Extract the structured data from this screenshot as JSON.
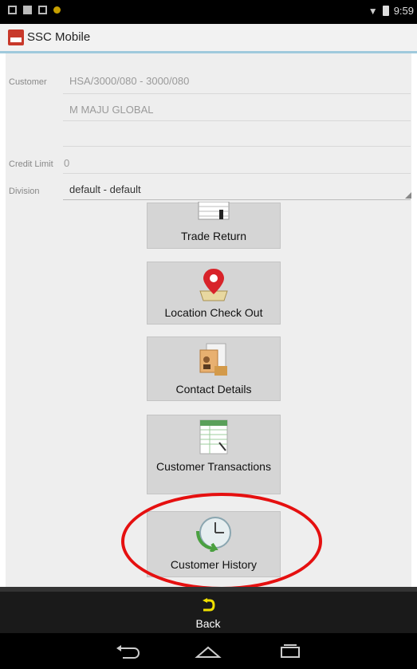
{
  "status_bar": {
    "time": "9:59",
    "icons": [
      "screenshot-icon",
      "sd-card-icon",
      "image-icon",
      "notification-dot-icon",
      "wifi-icon",
      "battery-icon"
    ]
  },
  "app": {
    "title": "SSC Mobile",
    "logo_icon": "ssc-logo-icon"
  },
  "form": {
    "customer_label": "Customer",
    "customer_code": "HSA/3000/080 - 3000/080",
    "customer_name": "M MAJU GLOBAL",
    "credit_limit_label": "Credit Limit",
    "credit_limit_value": "0",
    "division_label": "Division",
    "division_value": "default - default"
  },
  "tiles": [
    {
      "label": "Trade Return",
      "icon": "trade-return-icon"
    },
    {
      "label": "Location Check Out",
      "icon": "location-pin-icon"
    },
    {
      "label": "Contact Details",
      "icon": "contact-details-icon"
    },
    {
      "label": "Customer Transactions",
      "icon": "transactions-sheet-icon"
    },
    {
      "label": "Customer History",
      "icon": "clock-history-icon"
    }
  ],
  "bottom_bar": {
    "back_label": "Back",
    "back_icon": "back-arrow-icon"
  },
  "nav_bar": {
    "icons": [
      "nav-back-icon",
      "nav-home-icon",
      "nav-recents-icon"
    ]
  },
  "colors": {
    "highlight": "#e51010",
    "accent_line": "#9fc9dc",
    "tile_bg": "#d5d5d5",
    "back_arrow": "#f0e000"
  }
}
